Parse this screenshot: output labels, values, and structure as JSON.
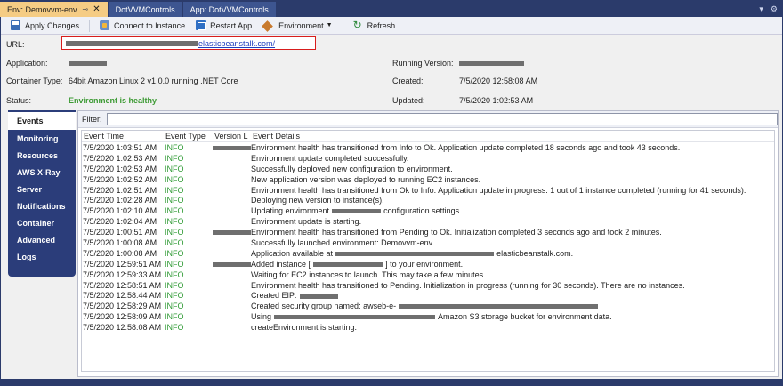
{
  "tabs": [
    {
      "label": "Env: Demovvm-env",
      "pin_icon": "pin-icon",
      "close_icon": "close-icon",
      "active": true
    },
    {
      "label": "DotVVMControls",
      "active": false
    },
    {
      "label": "App: DotVVMControls",
      "active": false
    }
  ],
  "tabtools": {
    "dropdown_glyph": "▾",
    "settings_glyph": "⚙"
  },
  "toolbar": {
    "apply": "Apply Changes",
    "connect": "Connect to Instance",
    "restart": "Restart App",
    "environment": "Environment",
    "refresh": "Refresh"
  },
  "info": {
    "url_label": "URL:",
    "url_suffix": "elasticbeanstalk.com/",
    "application_label": "Application:",
    "container_label": "Container Type:",
    "container_value": "64bit Amazon Linux 2 v1.0.0 running .NET Core",
    "status_label": "Status:",
    "status_value": "Environment is healthy",
    "running_version_label": "Running Version:",
    "created_label": "Created:",
    "created_value": "7/5/2020 12:58:08 AM",
    "updated_label": "Updated:",
    "updated_value": "7/5/2020 1:02:53 AM"
  },
  "nav": [
    "Events",
    "Monitoring",
    "Resources",
    "AWS X-Ray",
    "Server",
    "Notifications",
    "Container",
    "Advanced",
    "Logs"
  ],
  "filter": {
    "label": "Filter:",
    "value": ""
  },
  "grid": {
    "headers": [
      "Event Time",
      "Event Type",
      "Version L",
      "Event Details"
    ],
    "rows": [
      {
        "time": "7/5/2020 1:03:51 AM",
        "type": "INFO",
        "version_redacted": true,
        "details": "Environment health has transitioned from Info to Ok. Application update completed 18 seconds ago and took 43 seconds."
      },
      {
        "time": "7/5/2020 1:02:53 AM",
        "type": "INFO",
        "version_redacted": false,
        "details": "Environment update completed successfully."
      },
      {
        "time": "7/5/2020 1:02:53 AM",
        "type": "INFO",
        "version_redacted": false,
        "details": "Successfully deployed new configuration to environment."
      },
      {
        "time": "7/5/2020 1:02:52 AM",
        "type": "INFO",
        "version_redacted": false,
        "details": "New application version was deployed to running EC2 instances."
      },
      {
        "time": "7/5/2020 1:02:51 AM",
        "type": "INFO",
        "version_redacted": false,
        "details": "Environment health has transitioned from Ok to Info. Application update in progress. 1 out of 1 instance completed (running for 41 seconds)."
      },
      {
        "time": "7/5/2020 1:02:28 AM",
        "type": "INFO",
        "version_redacted": false,
        "details": "Deploying new version to instance(s)."
      },
      {
        "time": "7/5/2020 1:02:10 AM",
        "type": "INFO",
        "version_redacted": false,
        "details_pre": "Updating environment",
        "details_post": "configuration settings."
      },
      {
        "time": "7/5/2020 1:02:04 AM",
        "type": "INFO",
        "version_redacted": false,
        "details": "Environment update is starting."
      },
      {
        "time": "7/5/2020 1:00:51 AM",
        "type": "INFO",
        "version_redacted": true,
        "details": "Environment health has transitioned from Pending to Ok. Initialization completed 3 seconds ago and took 2 minutes."
      },
      {
        "time": "7/5/2020 1:00:08 AM",
        "type": "INFO",
        "version_redacted": false,
        "details": "Successfully launched environment: Demovvm-env"
      },
      {
        "time": "7/5/2020 1:00:08 AM",
        "type": "INFO",
        "version_redacted": false,
        "details_pre": "Application available at",
        "details_post": "elasticbeanstalk.com."
      },
      {
        "time": "7/5/2020 12:59:51 AM",
        "type": "INFO",
        "version_redacted": true,
        "details_pre": "Added instance [",
        "details_post": "] to your environment."
      },
      {
        "time": "7/5/2020 12:59:33 AM",
        "type": "INFO",
        "version_redacted": false,
        "details": "Waiting for EC2 instances to launch. This may take a few minutes."
      },
      {
        "time": "7/5/2020 12:58:51 AM",
        "type": "INFO",
        "version_redacted": false,
        "details": "Environment health has transitioned to Pending. Initialization in progress (running for 30 seconds). There are no instances."
      },
      {
        "time": "7/5/2020 12:58:44 AM",
        "type": "INFO",
        "version_redacted": false,
        "details_pre": "Created EIP:",
        "details_post": ""
      },
      {
        "time": "7/5/2020 12:58:29 AM",
        "type": "INFO",
        "version_redacted": false,
        "details_pre": "Created security group named: awseb-e-",
        "details_post": ""
      },
      {
        "time": "7/5/2020 12:58:09 AM",
        "type": "INFO",
        "version_redacted": false,
        "details_pre": "Using",
        "details_post": "Amazon S3 storage bucket for environment data."
      },
      {
        "time": "7/5/2020 12:58:08 AM",
        "type": "INFO",
        "version_redacted": false,
        "details": "createEnvironment is starting."
      }
    ]
  }
}
